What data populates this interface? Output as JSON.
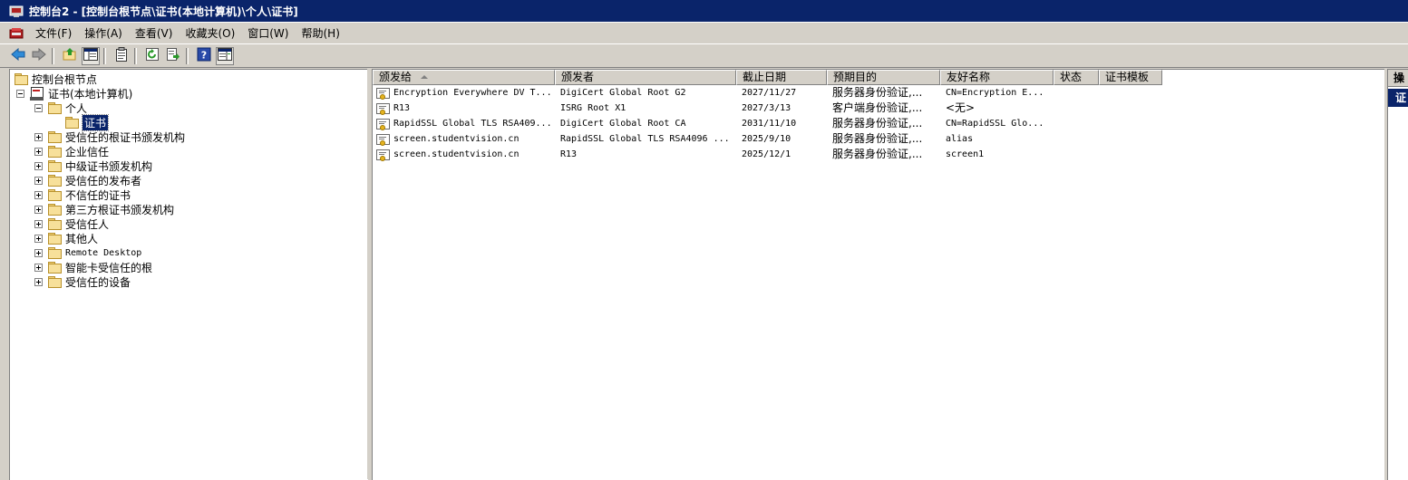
{
  "window": {
    "title": "控制台2 - [控制台根节点\\证书(本地计算机)\\个人\\证书]"
  },
  "menubar": {
    "items": [
      "文件(F)",
      "操作(A)",
      "查看(V)",
      "收藏夹(O)",
      "窗口(W)",
      "帮助(H)"
    ]
  },
  "toolbar": {
    "buttons": [
      "back-icon",
      "forward-icon",
      "up-folder-icon",
      "show-tree-icon",
      "properties-icon",
      "refresh-icon",
      "export-list-icon",
      "help-icon",
      "show-action-pane-icon"
    ]
  },
  "tree": {
    "root": "控制台根节点",
    "store": "证书(本地计算机)",
    "personal": "个人",
    "personal_child": "证书",
    "folders": [
      "受信任的根证书颁发机构",
      "企业信任",
      "中级证书颁发机构",
      "受信任的发布者",
      "不信任的证书",
      "第三方根证书颁发机构",
      "受信任人",
      "其他人",
      "Remote Desktop",
      "智能卡受信任的根",
      "受信任的设备"
    ]
  },
  "list": {
    "columns": [
      "颁发给",
      "颁发者",
      "截止日期",
      "预期目的",
      "友好名称",
      "状态",
      "证书模板"
    ],
    "rows": [
      [
        "Encryption Everywhere DV T...",
        "DigiCert Global Root G2",
        "2027/11/27",
        "服务器身份验证,...",
        "CN=Encryption E...",
        "",
        ""
      ],
      [
        "R13",
        "ISRG Root X1",
        "2027/3/13",
        "客户端身份验证,...",
        "<无>",
        "",
        ""
      ],
      [
        "RapidSSL Global TLS RSA409...",
        "DigiCert Global Root CA",
        "2031/11/10",
        "服务器身份验证,...",
        "CN=RapidSSL Glo...",
        "",
        ""
      ],
      [
        "screen.studentvision.cn",
        "RapidSSL Global TLS RSA4096 ...",
        "2025/9/10",
        "服务器身份验证,...",
        "alias",
        "",
        ""
      ],
      [
        "screen.studentvision.cn",
        "R13",
        "2025/12/1",
        "服务器身份验证,...",
        "screen1",
        "",
        ""
      ]
    ]
  },
  "action_pane": {
    "header": "操",
    "selected": "证"
  },
  "colors": {
    "titlebar": "#0a246a",
    "selection": "#0a246a",
    "chrome": "#d4d0c8"
  }
}
